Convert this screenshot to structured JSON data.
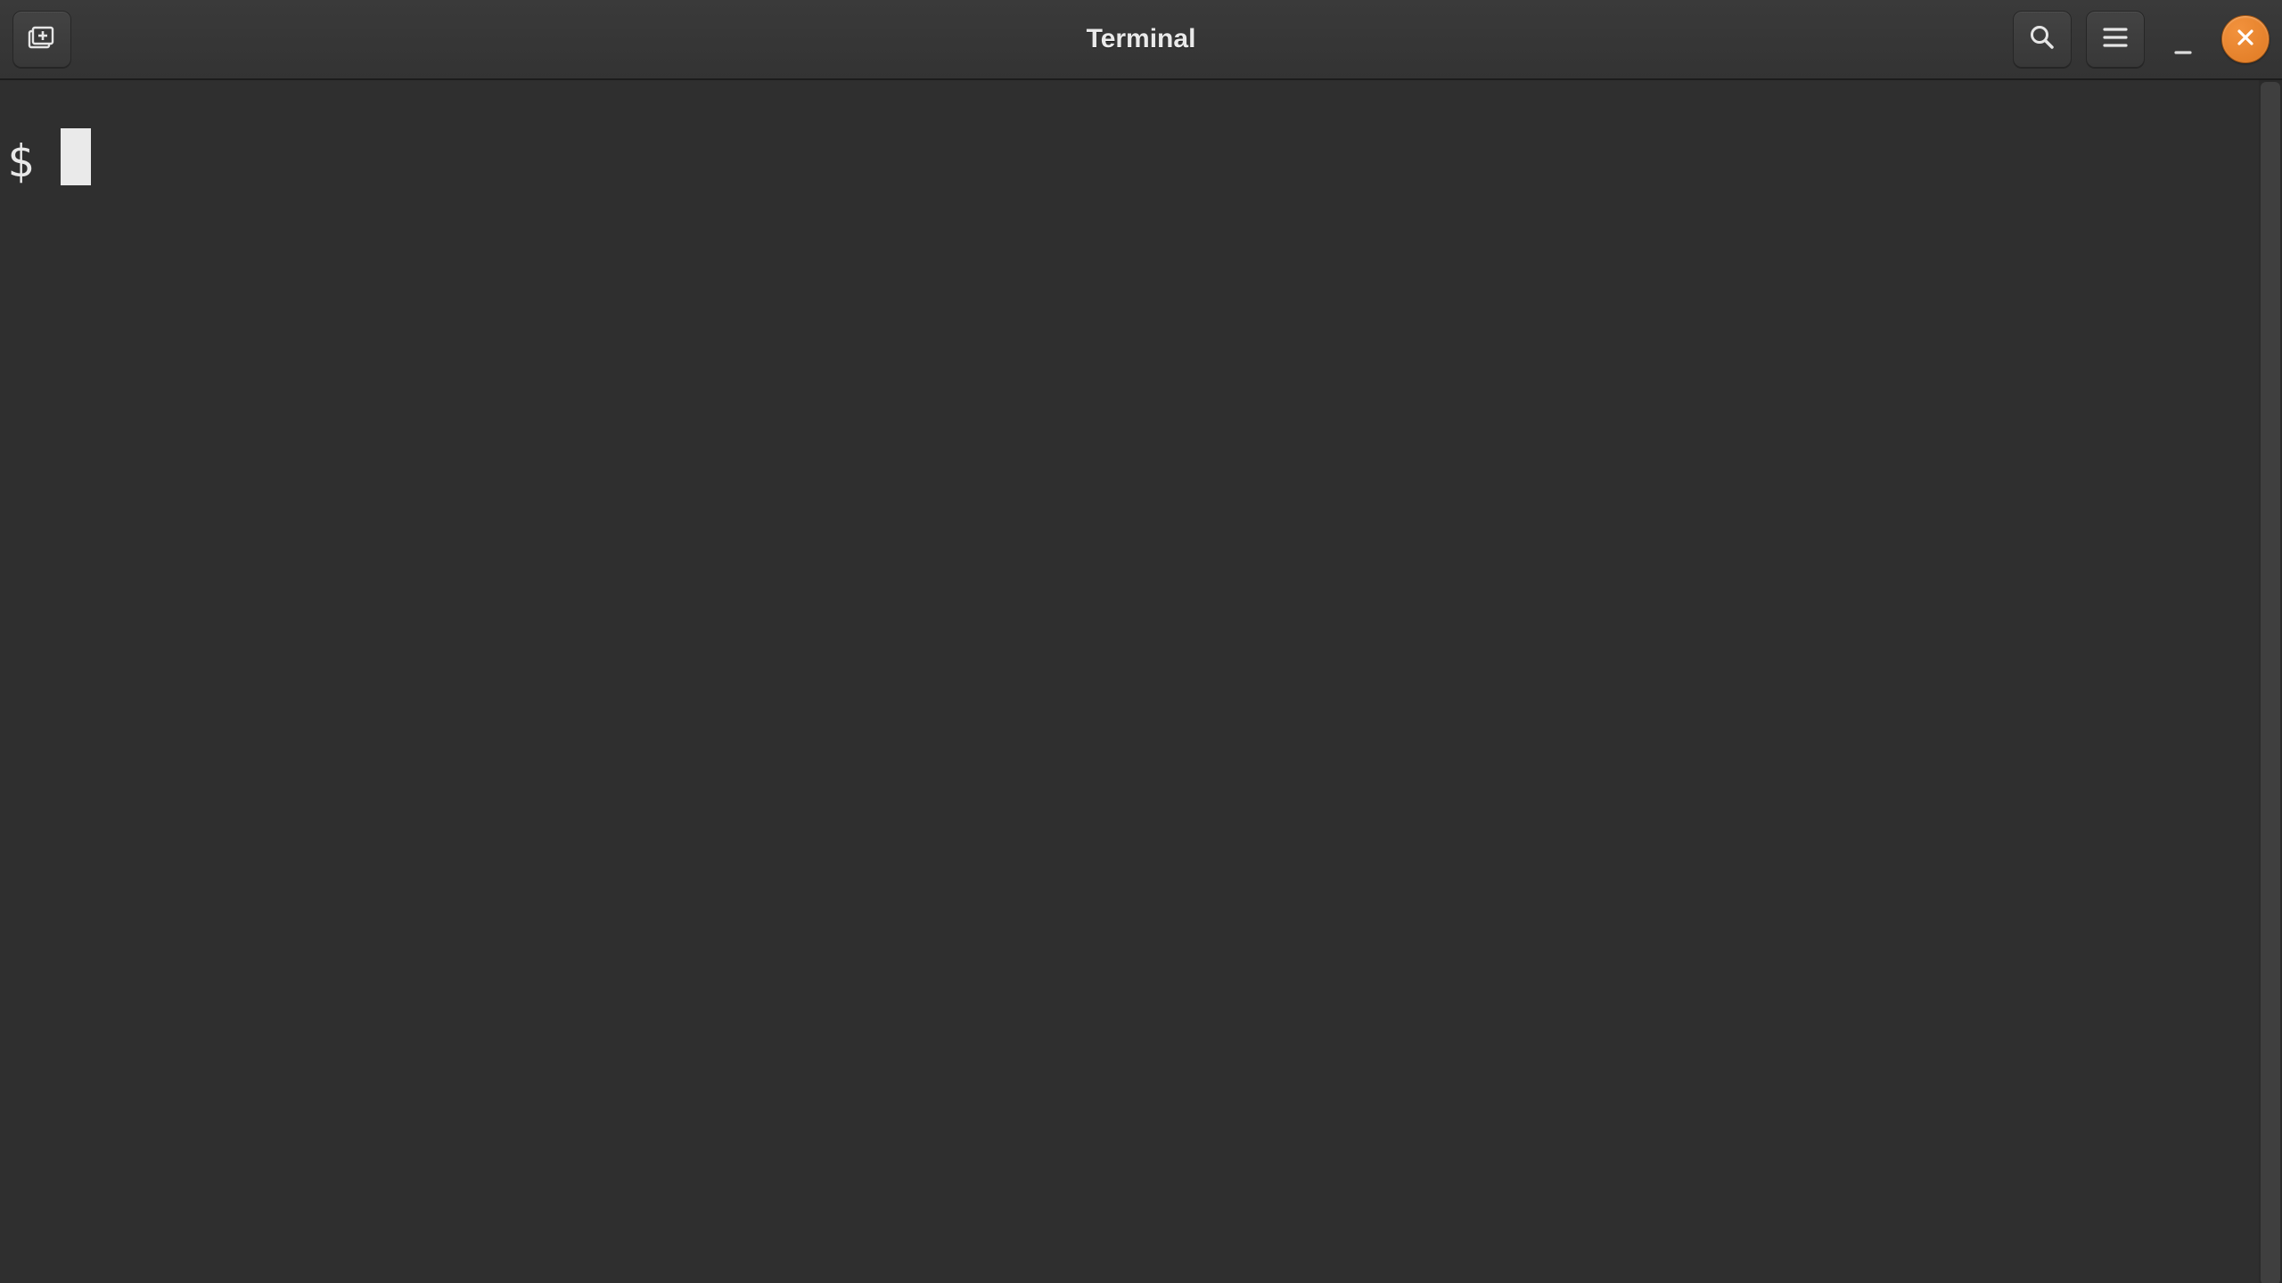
{
  "window": {
    "title": "Terminal"
  },
  "titlebar": {
    "new_tab_name": "new-tab",
    "search_name": "search",
    "menu_name": "menu",
    "minimize_name": "minimize",
    "close_name": "close"
  },
  "terminal": {
    "prompt": "$ ",
    "input_value": "",
    "cursor_visible": true
  },
  "colors": {
    "close_accent": "#e07b28",
    "bg": "#2f2f2f",
    "fg": "#eaeaea"
  }
}
